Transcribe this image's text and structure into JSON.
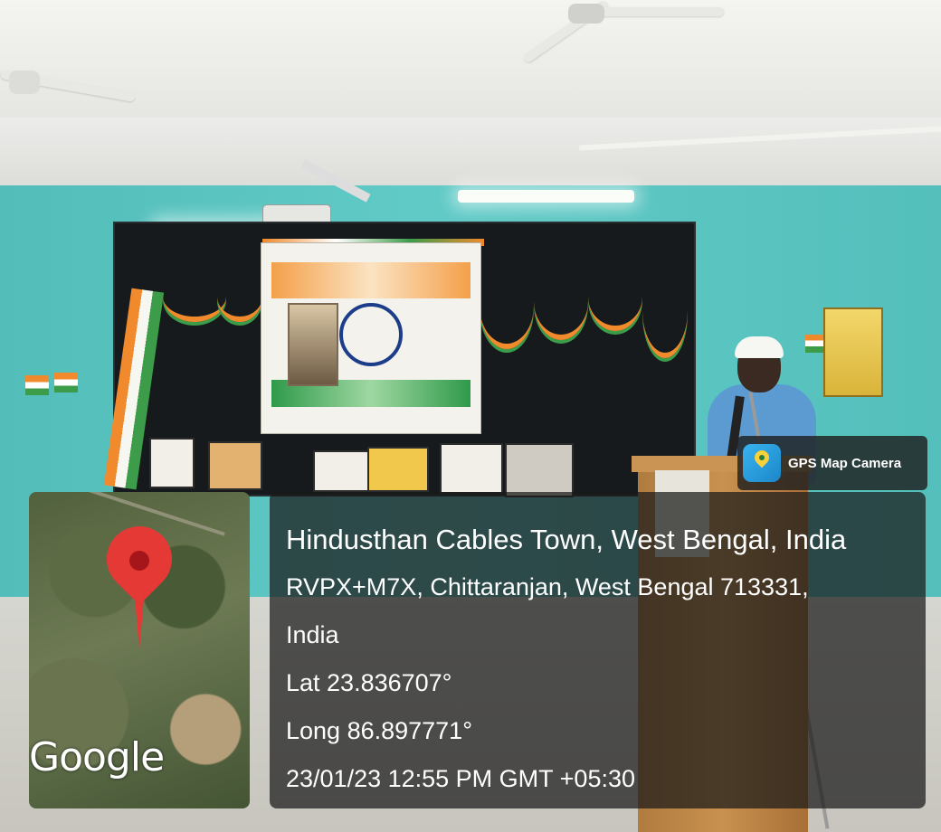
{
  "overlay": {
    "badge": {
      "label": "GPS Map Camera",
      "icon": "gps-map-camera-icon"
    },
    "map": {
      "provider_label": "Google",
      "marker": "location-pin-icon",
      "marker_color": "#e53935"
    },
    "location": {
      "title": "Hindusthan Cables Town, West Bengal, India",
      "address_line1": "RVPX+M7X, Chittaranjan, West Bengal 713331,",
      "address_line2": "India",
      "latitude": "Lat 23.836707°",
      "longitude": "Long 86.897771°",
      "datetime": "23/01/23 12:55 PM GMT +05:30"
    }
  },
  "scene": {
    "wall_color": "#57c7c3",
    "board_color": "#161a1c",
    "bunting_colors": [
      "#f08a2c",
      "#ffffff",
      "#3c9c4a"
    ]
  }
}
